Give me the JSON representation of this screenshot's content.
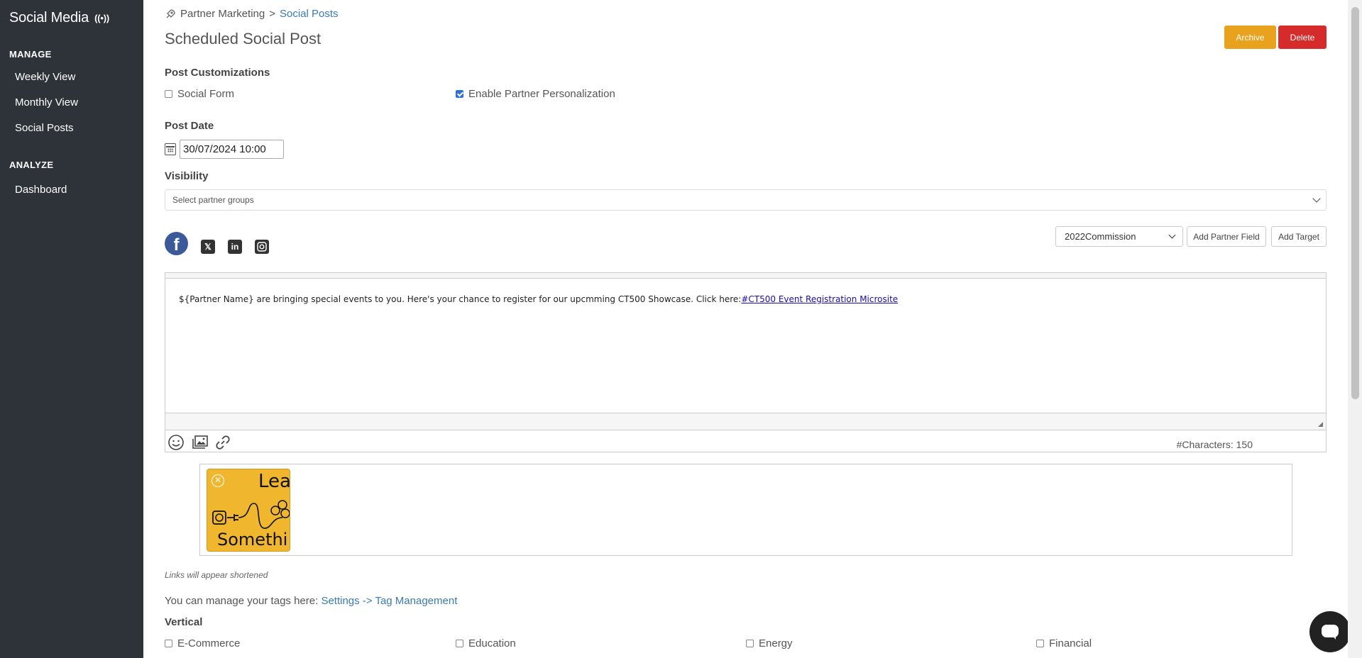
{
  "sidebar": {
    "title": "Social Media",
    "manage_label": "MANAGE",
    "analyze_label": "ANALYZE",
    "items": [
      {
        "label": "Weekly View"
      },
      {
        "label": "Monthly View"
      },
      {
        "label": "Social Posts"
      },
      {
        "label": "Dashboard"
      }
    ]
  },
  "breadcrumb": {
    "parent": "Partner Marketing",
    "separator": ">",
    "current": "Social Posts"
  },
  "page": {
    "title": "Scheduled Social Post",
    "archive_label": "Archive",
    "delete_label": "Delete"
  },
  "customizations": {
    "heading": "Post Customizations",
    "social_form_label": "Social Form",
    "social_form_checked": false,
    "partner_personalization_label": "Enable Partner Personalization",
    "partner_personalization_checked": true
  },
  "post_date": {
    "heading": "Post Date",
    "value": "30/07/2024 10:00"
  },
  "visibility": {
    "heading": "Visibility",
    "placeholder": "Select partner groups"
  },
  "networks": [
    "facebook",
    "x",
    "linkedin",
    "instagram"
  ],
  "editor_toolbar": {
    "field_select_value": "2022Commission",
    "add_partner_field_label": "Add Partner Field",
    "add_target_label": "Add Target"
  },
  "editor": {
    "text": "${Partner Name} are bringing special events to you. Here's your chance to register for our upcmming CT500 Showcase. Click here:",
    "link_text": "#CT500 Event Registration Microsite",
    "char_count": "#Characters: 150"
  },
  "image": {
    "text_top": "Lea",
    "text_bottom": "Somethi"
  },
  "notes": {
    "links_note": "Links will appear shortened",
    "tags_prefix": "You can manage your tags here:",
    "tags_link": "Settings -> Tag Management"
  },
  "vertical": {
    "heading": "Vertical",
    "options": [
      {
        "label": "E-Commerce",
        "checked": false
      },
      {
        "label": "Education",
        "checked": false
      },
      {
        "label": "Energy",
        "checked": false
      },
      {
        "label": "Financial",
        "checked": false
      }
    ]
  },
  "colors": {
    "sidebar_bg": "#2d3339",
    "archive": "#e8a21d",
    "delete": "#d52b2b",
    "link": "#3a7bb0",
    "facebook": "#3b5a9a"
  }
}
